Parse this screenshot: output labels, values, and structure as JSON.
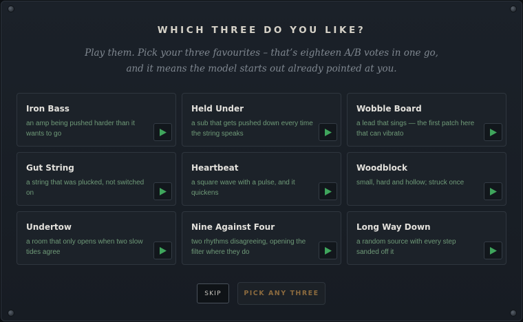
{
  "header": {
    "title": "WHICH THREE DO YOU LIKE?",
    "subtitle_line1": "Play them. Pick your three favourites – that’s eighteen A/B votes in one go,",
    "subtitle_line2": "and it means the model starts out already pointed at you."
  },
  "colors": {
    "accent_green": "#3fa55c",
    "description_green": "#6f9a78",
    "pick_gold": "#8b6a3e"
  },
  "sounds": [
    {
      "name": "Iron Bass",
      "description": "an amp being pushed harder than it wants to go",
      "play_icon": "play-icon"
    },
    {
      "name": "Held Under",
      "description": "a sub that gets pushed down every time the string speaks",
      "play_icon": "play-icon"
    },
    {
      "name": "Wobble Board",
      "description": "a lead that sings — the first patch here that can vibrato",
      "play_icon": "play-icon"
    },
    {
      "name": "Gut String",
      "description": "a string that was plucked, not switched on",
      "play_icon": "play-icon"
    },
    {
      "name": "Heartbeat",
      "description": "a square wave with a pulse, and it quickens",
      "play_icon": "play-icon"
    },
    {
      "name": "Woodblock",
      "description": "small, hard and hollow; struck once",
      "play_icon": "play-icon"
    },
    {
      "name": "Undertow",
      "description": "a room that only opens when two slow tides agree",
      "play_icon": "play-icon"
    },
    {
      "name": "Nine Against Four",
      "description": "two rhythms disagreeing, opening the filter where they do",
      "play_icon": "play-icon"
    },
    {
      "name": "Long Way Down",
      "description": "a random source with every step sanded off it",
      "play_icon": "play-icon"
    }
  ],
  "footer": {
    "skip_label": "SKIP",
    "pick_label": "PICK ANY THREE"
  }
}
